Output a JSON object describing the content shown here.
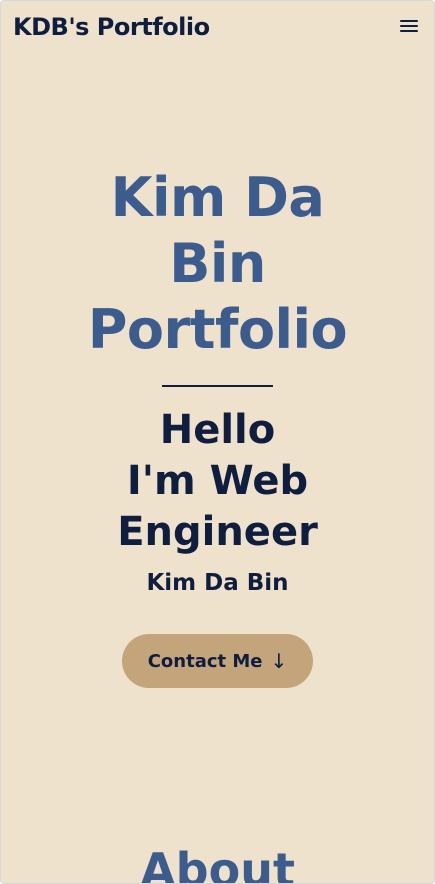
{
  "header": {
    "brand": "KDB's Portfolio",
    "menu_icon": "hamburger-menu-icon"
  },
  "hero": {
    "title_lines": [
      "Kim Da",
      "Bin",
      "Portfolio"
    ],
    "subtitle_lines": [
      "Hello",
      "I'm Web",
      "Engineer"
    ],
    "name": "Kim Da Bin",
    "contact_label": "Contact Me",
    "contact_icon": "↓"
  },
  "about": {
    "heading": "About"
  },
  "colors": {
    "background": "#efe2cd",
    "navy": "#0f1d3f",
    "blue": "#3d5c8e",
    "button": "#c4a57b"
  }
}
